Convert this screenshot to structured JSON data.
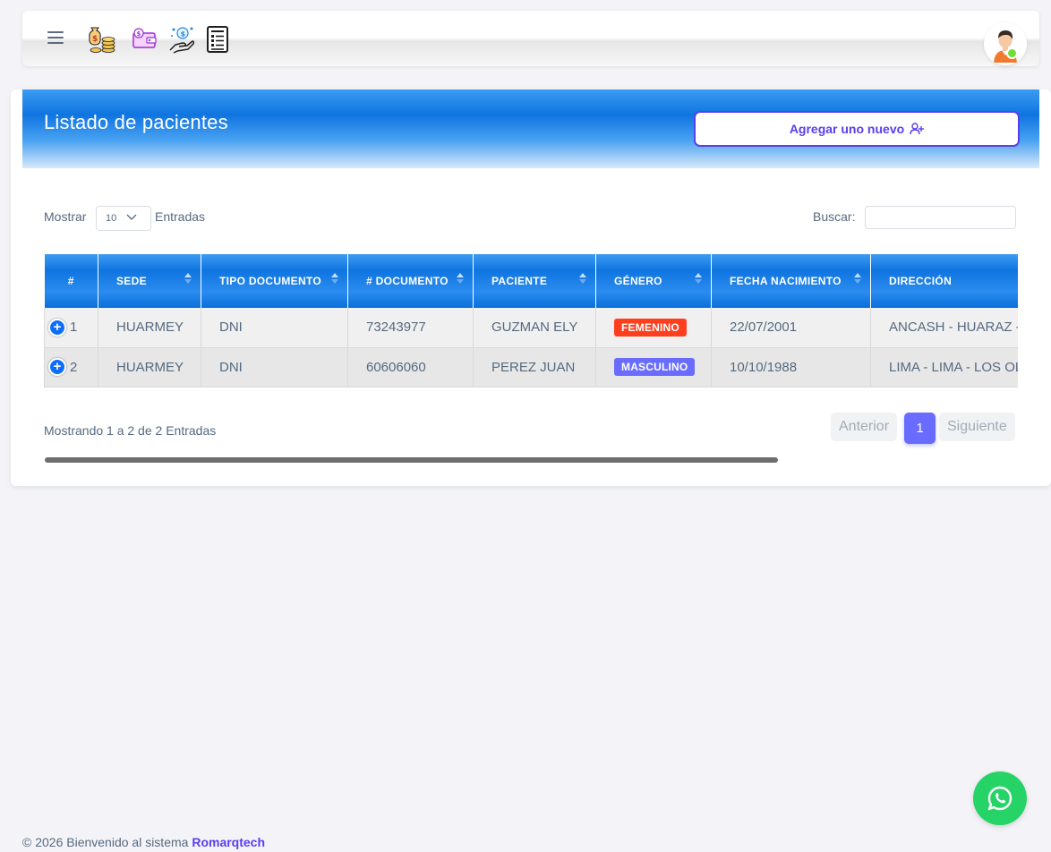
{
  "navbar": {
    "icons": [
      "menu-icon",
      "money-bags-icon",
      "wallet-icon",
      "payment-hand-icon",
      "invoice-icon"
    ],
    "avatar": "user-avatar",
    "avatar_status_color": "#71dd37"
  },
  "card": {
    "title": "Listado de pacientes",
    "add_button_label": "Agregar uno nuevo",
    "add_button_color": "#5a3df0"
  },
  "table_controls": {
    "show_label": "Mostrar",
    "entries_value": "10",
    "entries_label": "Entradas",
    "search_label": "Buscar:",
    "search_value": ""
  },
  "table": {
    "columns": [
      "#",
      "SEDE",
      "TIPO DOCUMENTO",
      "# DOCUMENTO",
      "PACIENTE",
      "GÉNERO",
      "FECHA NACIMIENTO",
      "DIRECCIÓN"
    ],
    "rows": [
      {
        "num": "1",
        "sede": "HUARMEY",
        "tipo": "DNI",
        "documento": "73243977",
        "paciente": "GUZMAN ELY",
        "genero": "FEMENINO",
        "genero_color": "#ff3e1d",
        "fecha": "22/07/2001",
        "direccion": "ANCASH - HUARAZ -"
      },
      {
        "num": "2",
        "sede": "HUARMEY",
        "tipo": "DNI",
        "documento": "60606060",
        "paciente": "PEREZ JUAN",
        "genero": "MASCULINO",
        "genero_color": "#696cff",
        "fecha": "10/10/1988",
        "direccion": "LIMA - LIMA - LOS OL"
      }
    ]
  },
  "pagination": {
    "info": "Mostrando 1 a 2 de 2 Entradas",
    "prev_label": "Anterior",
    "current_page": "1",
    "next_label": "Siguiente"
  },
  "footer": {
    "text": "© 2026 Bienvenido al sistema",
    "brand": "Romarqtech"
  },
  "whatsapp": "whatsapp-icon"
}
